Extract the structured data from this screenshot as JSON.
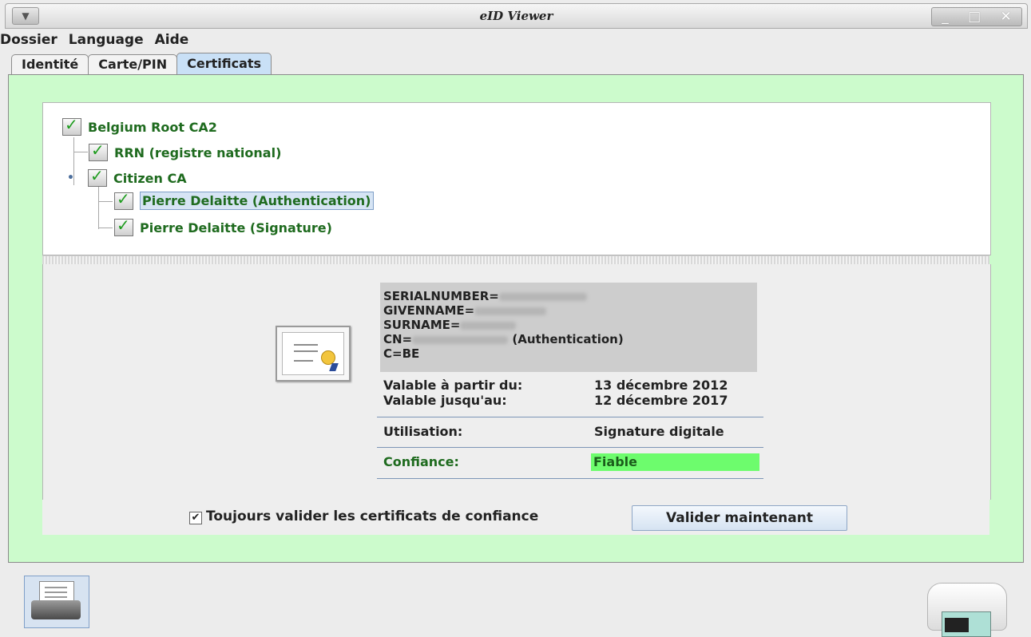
{
  "window": {
    "title": "eID Viewer",
    "controls": [
      "_",
      "□",
      "✕"
    ]
  },
  "menubar": {
    "items": [
      "Dossier",
      "Language",
      "Aide"
    ]
  },
  "tabs": [
    {
      "label": "Identité",
      "active": false
    },
    {
      "label": "Carte/PIN",
      "active": false
    },
    {
      "label": "Certificats",
      "active": true
    }
  ],
  "tree": {
    "root": "Belgium Root CA2",
    "rrn": "RRN (registre national)",
    "citizen_ca": "Citizen CA",
    "auth": "Pierre Delaitte (Authentication)",
    "sign": "Pierre Delaitte (Signature)"
  },
  "details": {
    "serial_prefix": "SERIALNUMBER=",
    "givenname_prefix": "GIVENNAME=",
    "surname_prefix": "SURNAME=",
    "cn_prefix": "CN=",
    "cn_suffix": "(Authentication)",
    "country": "C=BE",
    "valid_from_label": "Valable à partir du:",
    "valid_from": "13 décembre 2012",
    "valid_to_label": "Valable jusqu'au:",
    "valid_to": "12 décembre 2017",
    "usage_label": "Utilisation:",
    "usage": "Signature digitale",
    "trust_label": "Confiance:",
    "trust": "Fiable"
  },
  "footer": {
    "always_validate_label": "Toujours valider les certificats de confiance",
    "always_validate_checked": true,
    "checkbox_mark": "✔",
    "validate_now_label": "Valider maintenant"
  },
  "colors": {
    "content_bg": "#ccfbcc",
    "tree_text": "#1f6b1f",
    "trust_bg": "#6dfc6d",
    "selected_bg": "#d6e4f4"
  },
  "icons": [
    "window-menu-icon",
    "certificate-icon",
    "printer-icon",
    "card-reader-icon",
    "cert-check-icon"
  ]
}
